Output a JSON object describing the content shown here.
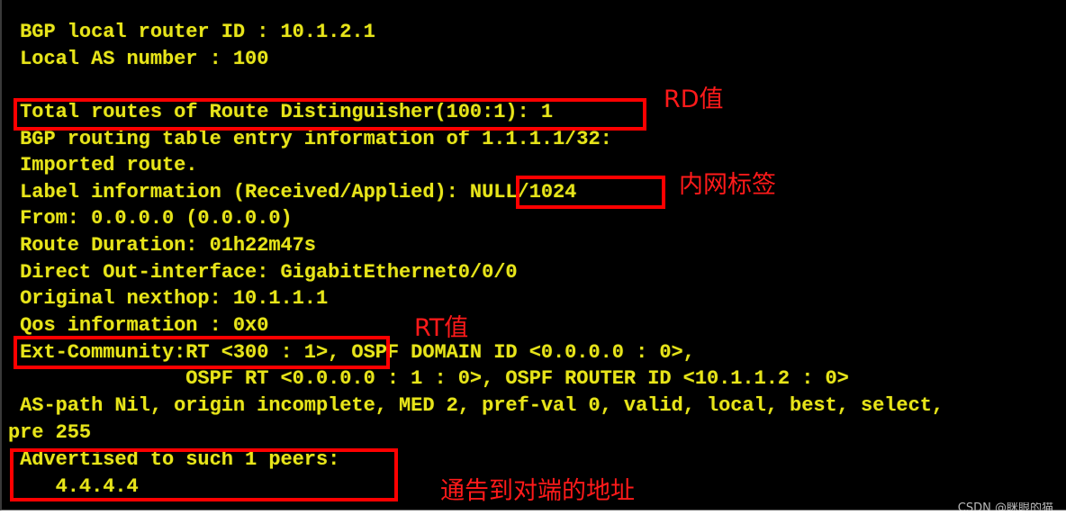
{
  "terminal": {
    "lines": [
      " BGP local router ID : 10.1.2.1",
      " Local AS number : 100",
      "",
      " Total routes of Route Distinguisher(100:1): 1",
      " BGP routing table entry information of 1.1.1.1/32:",
      " Imported route.",
      " Label information (Received/Applied): NULL/1024",
      " From: 0.0.0.0 (0.0.0.0)",
      " Route Duration: 01h22m47s",
      " Direct Out-interface: GigabitEthernet0/0/0",
      " Original nexthop: 10.1.1.1",
      " Qos information : 0x0",
      " Ext-Community:RT <300 : 1>, OSPF DOMAIN ID <0.0.0.0 : 0>,",
      "               OSPF RT <0.0.0.0 : 1 : 0>, OSPF ROUTER ID <10.1.1.2 : 0>",
      " AS-path Nil, origin incomplete, MED 2, pref-val 0, valid, local, best, select,",
      "pre 255",
      " Advertised to such 1 peers:",
      "    4.4.4.4"
    ]
  },
  "annotations": {
    "rd_label": "RD值",
    "inner_label": "内网标签",
    "rt_label": "RT值",
    "advertised_label": "通告到对端的地址"
  },
  "colors": {
    "terminal_bg": "#000000",
    "terminal_text": "#e8e41a",
    "annotation": "#ff0000"
  },
  "watermark": "CSDN @眯眼的猫"
}
